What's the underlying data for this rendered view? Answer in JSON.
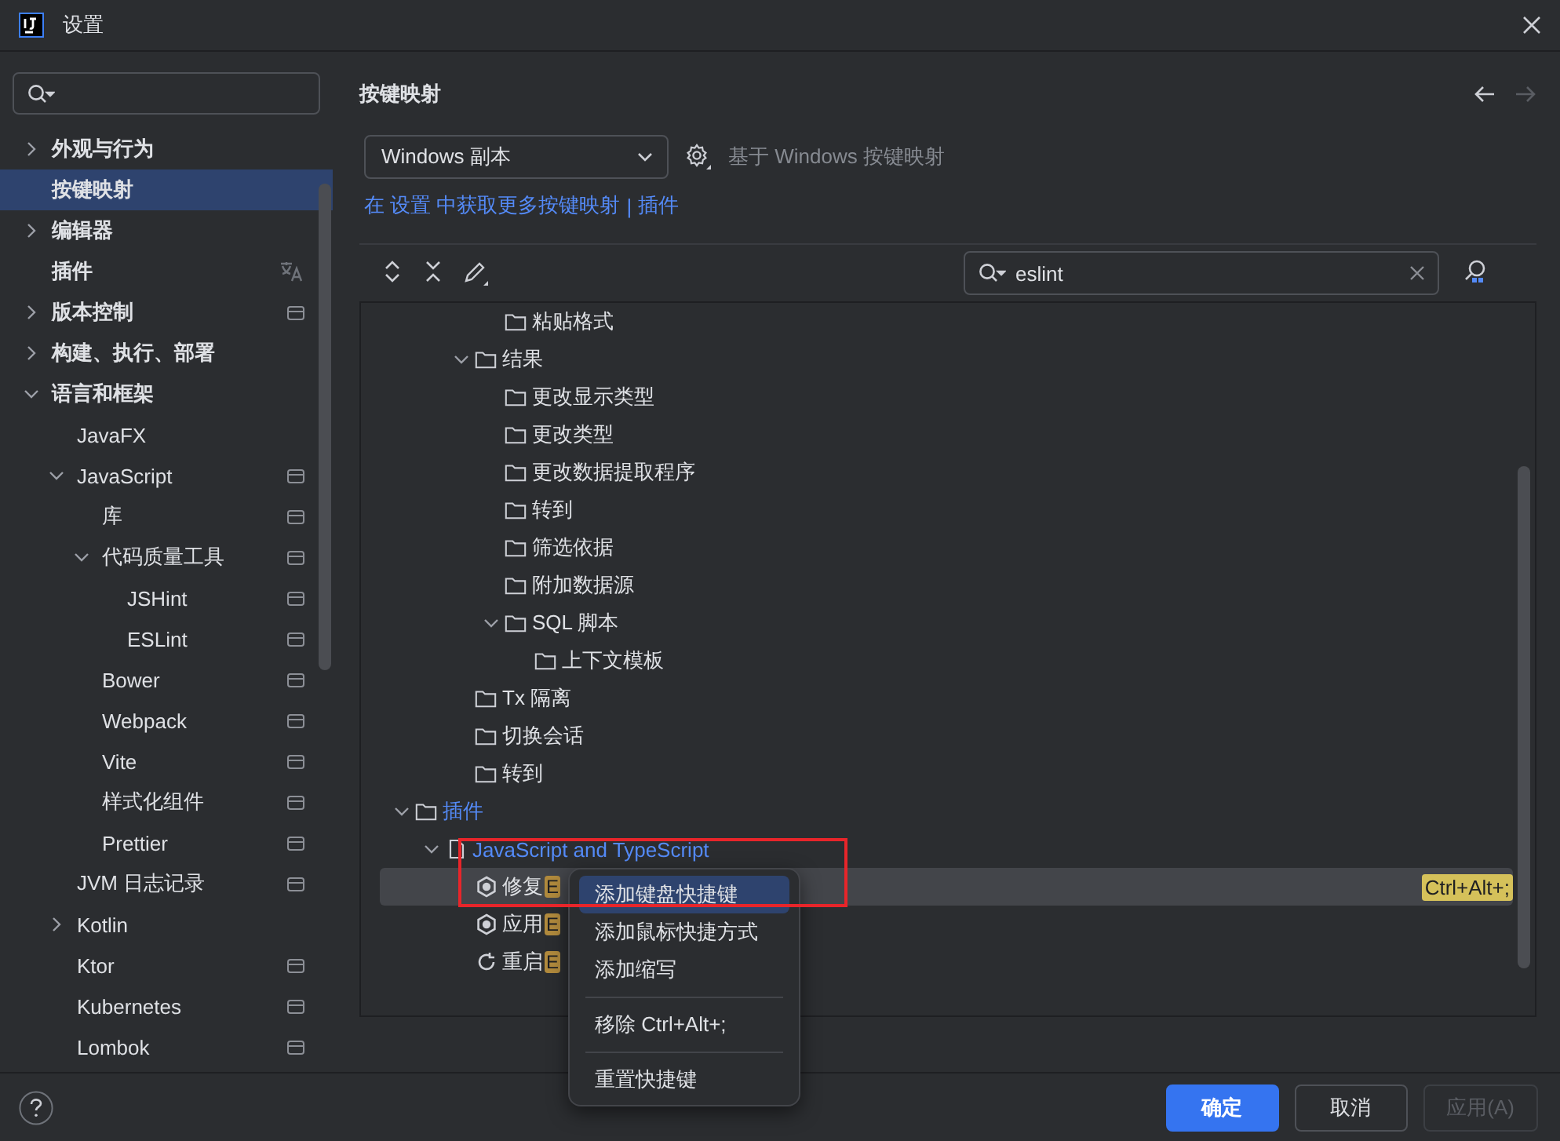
{
  "window": {
    "title": "设置"
  },
  "sidebar": {
    "items": [
      {
        "label": "外观与行为",
        "expanded": false,
        "selected": false
      },
      {
        "label": "按键映射",
        "selected": true
      },
      {
        "label": "编辑器",
        "expanded": false,
        "selected": false
      },
      {
        "label": "插件",
        "localized": true,
        "selected": false
      },
      {
        "label": "版本控制",
        "expanded": false,
        "project_level": true,
        "selected": false
      },
      {
        "label": "构建、执行、部署",
        "expanded": false,
        "selected": false
      },
      {
        "label": "语言和框架",
        "expanded": true,
        "selected": false,
        "children": [
          {
            "label": "JavaFX",
            "selected": false
          },
          {
            "label": "JavaScript",
            "expanded": true,
            "project_level": true,
            "selected": false,
            "children": [
              {
                "label": "库",
                "project_level": true,
                "selected": false
              },
              {
                "label": "代码质量工具",
                "expanded": true,
                "project_level": true,
                "selected": false,
                "children": [
                  {
                    "label": "JSHint",
                    "project_level": true,
                    "selected": false
                  },
                  {
                    "label": "ESLint",
                    "project_level": true,
                    "selected": false
                  }
                ]
              },
              {
                "label": "Bower",
                "project_level": true,
                "selected": false
              },
              {
                "label": "Webpack",
                "project_level": true,
                "selected": false
              },
              {
                "label": "Vite",
                "project_level": true,
                "selected": false
              },
              {
                "label": "样式化组件",
                "project_level": true,
                "selected": false
              },
              {
                "label": "Prettier",
                "project_level": true,
                "selected": false
              }
            ]
          },
          {
            "label": "JVM 日志记录",
            "project_level": true,
            "selected": false
          },
          {
            "label": "Kotlin",
            "expanded": false,
            "selected": false
          },
          {
            "label": "Ktor",
            "project_level": true,
            "selected": false
          },
          {
            "label": "Kubernetes",
            "project_level": true,
            "selected": false
          },
          {
            "label": "Lombok",
            "project_level": true,
            "selected": false
          }
        ]
      }
    ]
  },
  "panel": {
    "title": "按键映射",
    "keymap": {
      "value": "Windows 副本",
      "based_on": "基于 Windows 按键映射"
    },
    "links": [
      {
        "text": "在 设置 中获取更多按键映射"
      },
      {
        "text": "|"
      },
      {
        "text": "插件"
      }
    ],
    "search": {
      "value": "eslint"
    },
    "tree": [
      {
        "children": [
          {
            "children": [
              {
                "children": [
                  {
                    "label": "粘贴格式",
                    "kind": "folder"
                  }
                ]
              },
              {
                "label": "结果",
                "kind": "folder",
                "expanded": true,
                "children": [
                  {
                    "label": "更改显示类型",
                    "kind": "folder"
                  },
                  {
                    "label": "更改类型",
                    "kind": "folder"
                  },
                  {
                    "label": "更改数据提取程序",
                    "kind": "folder"
                  },
                  {
                    "label": "转到",
                    "kind": "folder"
                  },
                  {
                    "label": "筛选依据",
                    "kind": "folder"
                  },
                  {
                    "label": "附加数据源",
                    "kind": "folder"
                  },
                  {
                    "label": "SQL 脚本",
                    "kind": "folder",
                    "expanded": true,
                    "children": [
                      {
                        "label": "上下文模板",
                        "kind": "folder"
                      }
                    ]
                  }
                ]
              },
              {
                "label": "Tx 隔离",
                "kind": "folder"
              },
              {
                "label": "切换会话",
                "kind": "folder"
              },
              {
                "label": "转到",
                "kind": "folder"
              }
            ]
          }
        ]
      },
      {
        "label": "插件",
        "kind": "folder",
        "expanded": true,
        "match": true,
        "children": [
          {
            "label": "JavaScript and TypeScript",
            "kind": "plugin",
            "expanded": true,
            "match": true,
            "children": [
              {
                "label": "修复",
                "kind": "action",
                "badge": "E",
                "shortcut": "Ctrl+Alt+;",
                "selected": true
              },
              {
                "label": "应用",
                "kind": "action",
                "badge": "E",
                "selected": false
              },
              {
                "label": "重启",
                "kind": "restart",
                "badge": "E",
                "selected": false
              }
            ]
          }
        ]
      }
    ]
  },
  "context_menu": {
    "items": [
      {
        "label": "添加键盘快捷键",
        "kind": "item",
        "selected": true
      },
      {
        "label": "添加鼠标快捷方式",
        "kind": "item",
        "selected": false
      },
      {
        "label": "添加缩写",
        "kind": "item",
        "selected": false
      },
      {
        "kind": "separator"
      },
      {
        "label": "移除 Ctrl+Alt+;",
        "kind": "item",
        "selected": false
      },
      {
        "kind": "separator"
      },
      {
        "label": "重置快捷键",
        "kind": "item",
        "selected": false
      }
    ]
  },
  "buttons": [
    {
      "label": "确定",
      "kind": "primary",
      "disabled": false
    },
    {
      "label": "取消",
      "kind": "normal",
      "disabled": false
    },
    {
      "label": "应用(A)",
      "kind": "normal",
      "disabled": true
    }
  ]
}
